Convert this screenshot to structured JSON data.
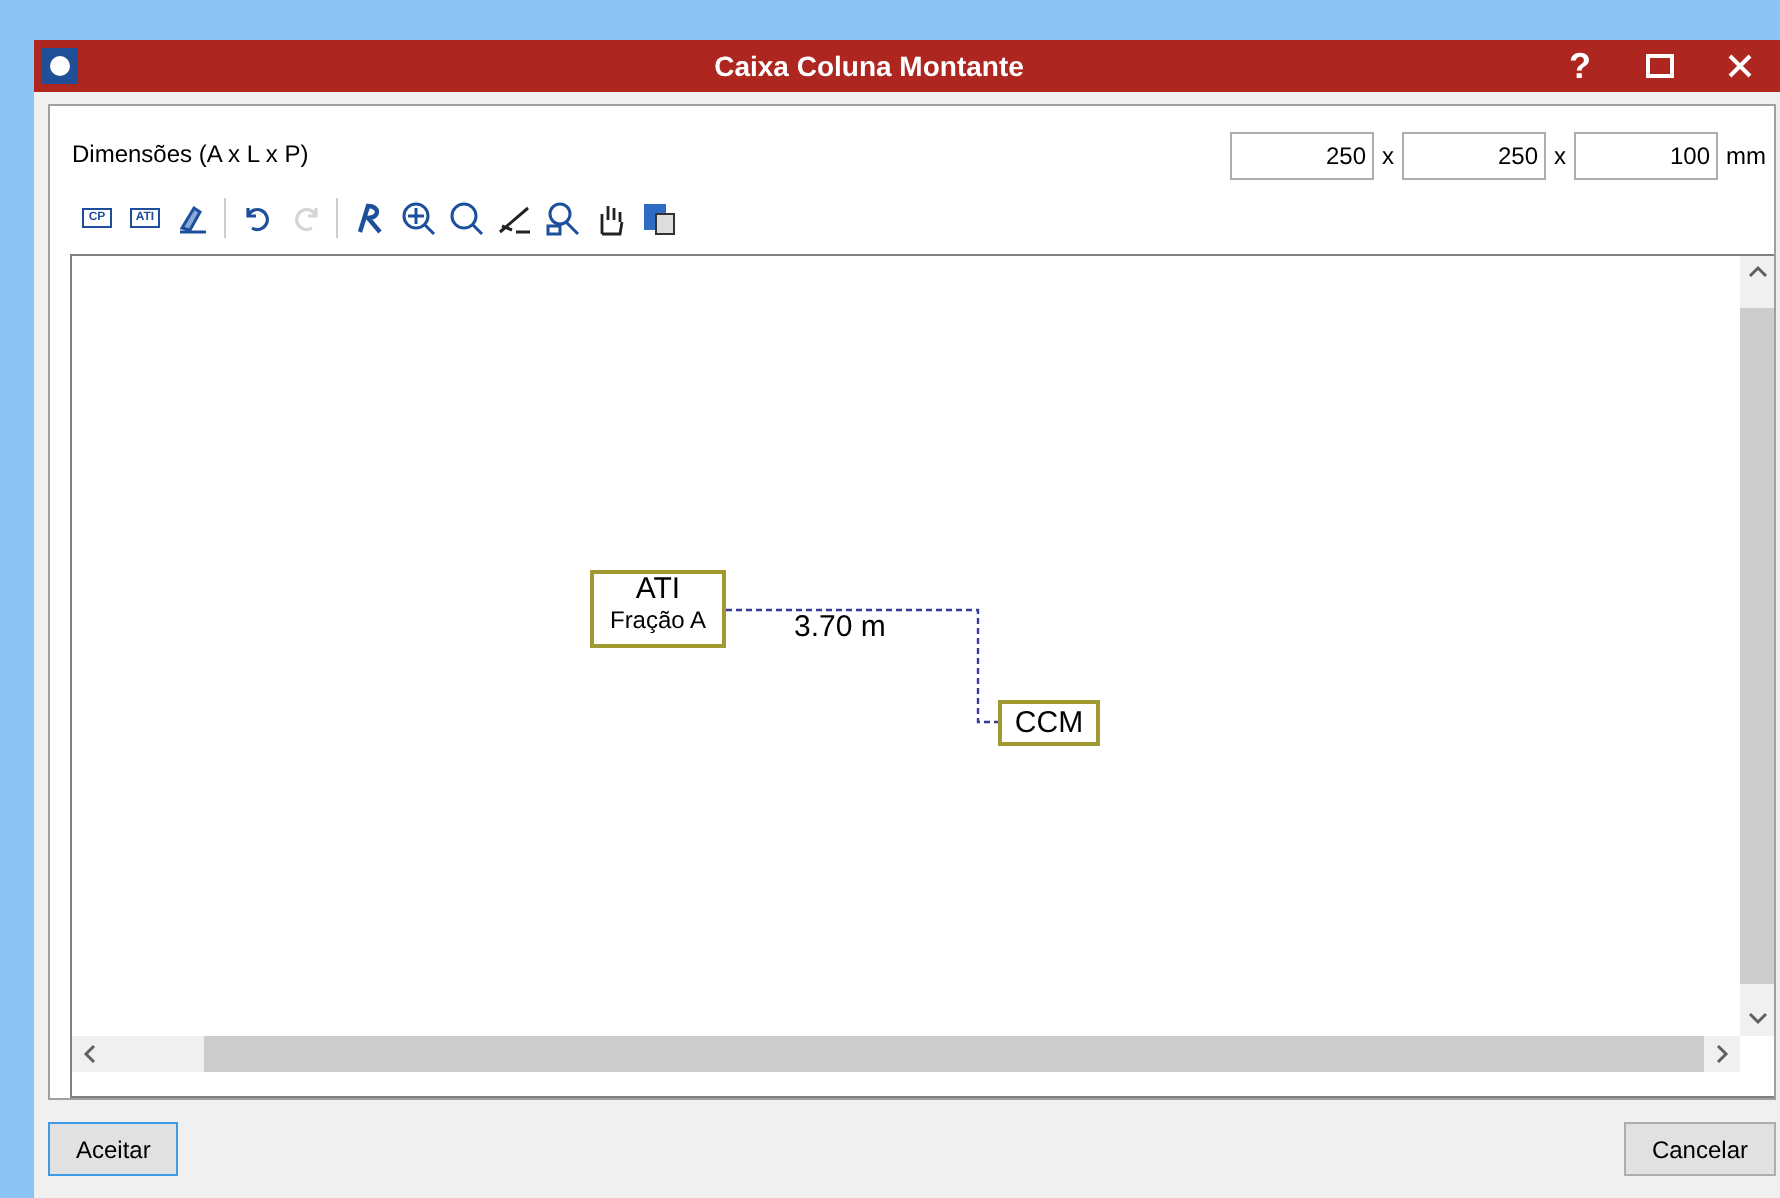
{
  "window": {
    "title": "Caixa Coluna Montante",
    "controls": [
      "?"
    ]
  },
  "dimensions": {
    "label": "Dimensões (A x L x P)",
    "fields": [
      {
        "value": "250",
        "sep": "x"
      },
      {
        "value": "250",
        "sep": "x"
      },
      {
        "value": "100",
        "sep": "mm"
      }
    ]
  },
  "toolbar": [
    [
      {
        "kind": "label",
        "label": "CP",
        "disabled": false
      },
      {
        "kind": "label",
        "label": "ATI",
        "disabled": false
      },
      {
        "kind": "icon",
        "disabled": false
      }
    ],
    [
      {
        "kind": "icon",
        "disabled": false
      },
      {
        "kind": "icon",
        "disabled": true
      }
    ],
    [
      {
        "kind": "icon",
        "disabled": false
      },
      {
        "kind": "icon",
        "disabled": false
      },
      {
        "kind": "icon",
        "disabled": false
      },
      {
        "kind": "icon",
        "disabled": false
      },
      {
        "kind": "icon",
        "disabled": false
      },
      {
        "kind": "icon",
        "disabled": false
      },
      {
        "kind": "icon",
        "disabled": false
      }
    ]
  ],
  "diagram": {
    "source": {
      "title": "ATI",
      "subtitle": "Fração A"
    },
    "target": {
      "title": "CCM"
    },
    "link": {
      "label": "3.70 m"
    }
  },
  "buttons": [
    {
      "label": "Aceitar",
      "selected": true
    },
    {
      "label": "Cancelar",
      "selected": false
    }
  ]
}
